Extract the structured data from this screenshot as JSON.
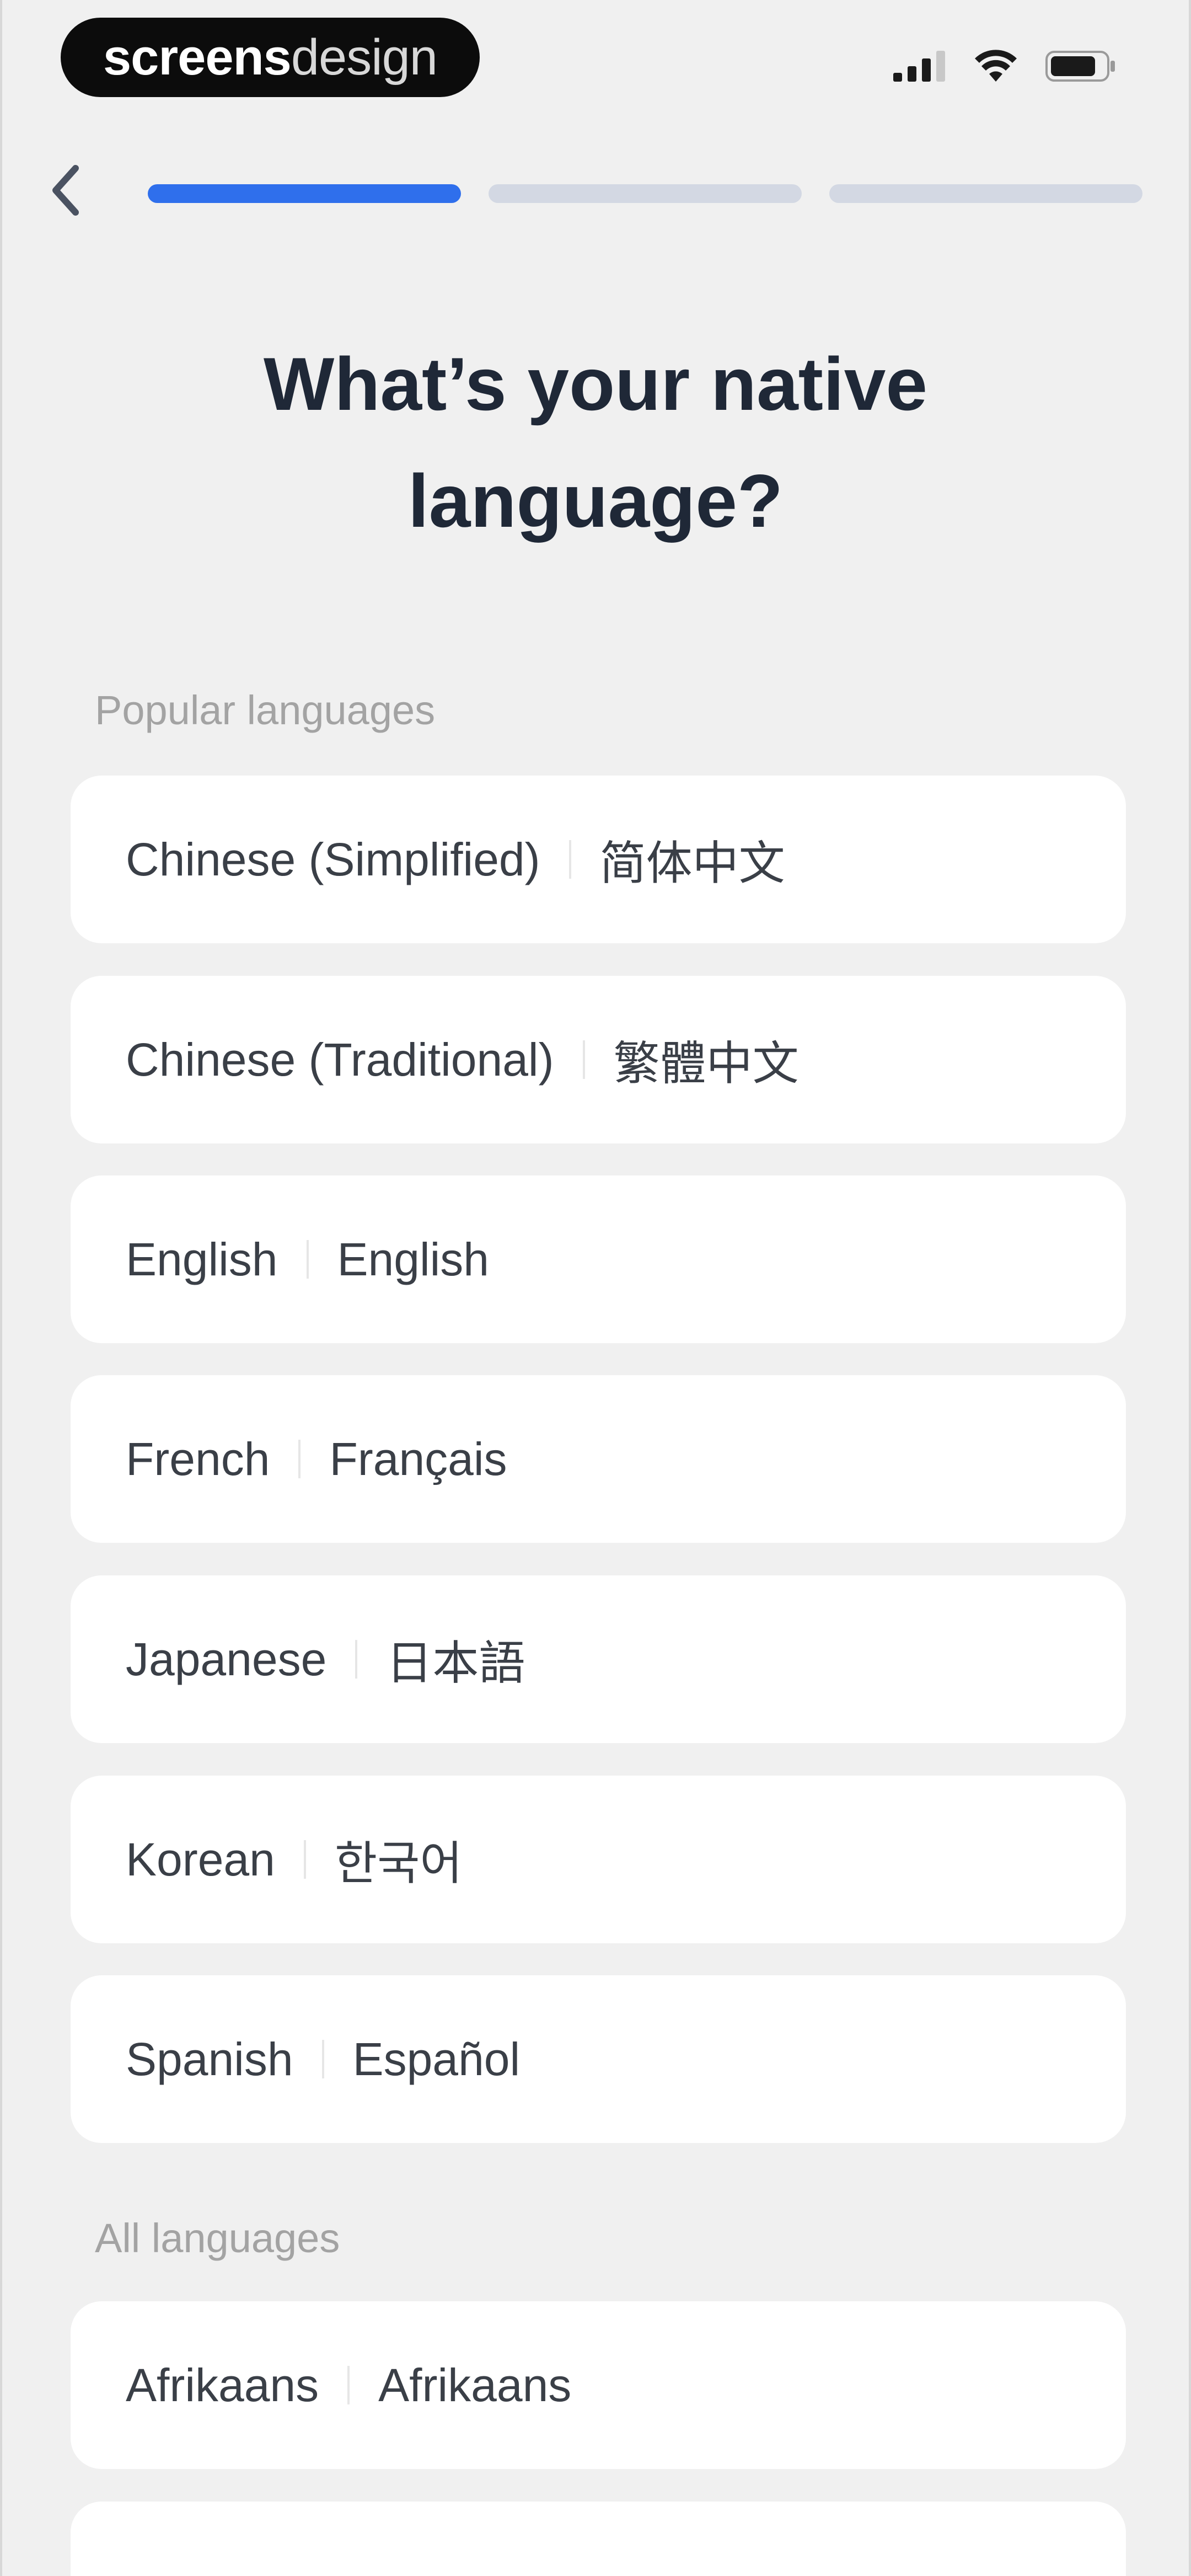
{
  "status_bar": {
    "brand_bold": "screens",
    "brand_light": "design",
    "icons": [
      "signal-icon",
      "wifi-icon",
      "battery-icon"
    ]
  },
  "nav": {
    "back_icon": "chevron-left-icon",
    "progress": {
      "steps": 3,
      "current": 1
    }
  },
  "title": "What’s your native language?",
  "popular": {
    "label": "Popular languages",
    "items": [
      {
        "en": "Chinese (Simplified)",
        "native": "简体中文"
      },
      {
        "en": "Chinese (Traditional)",
        "native": "繁體中文"
      },
      {
        "en": "English",
        "native": "English"
      },
      {
        "en": "French",
        "native": "Français"
      },
      {
        "en": "Japanese",
        "native": "日本語"
      },
      {
        "en": "Korean",
        "native": "한국어"
      },
      {
        "en": "Spanish",
        "native": "Español"
      }
    ]
  },
  "all": {
    "label": "All languages",
    "items": [
      {
        "en": "Afrikaans",
        "native": "Afrikaans"
      }
    ]
  },
  "colors": {
    "background": "#f0f0f0",
    "card": "#ffffff",
    "accent": "#2f6fec",
    "progress_inactive": "#d3d8e3",
    "title": "#1f2837",
    "section_label": "#a3a3a3"
  }
}
